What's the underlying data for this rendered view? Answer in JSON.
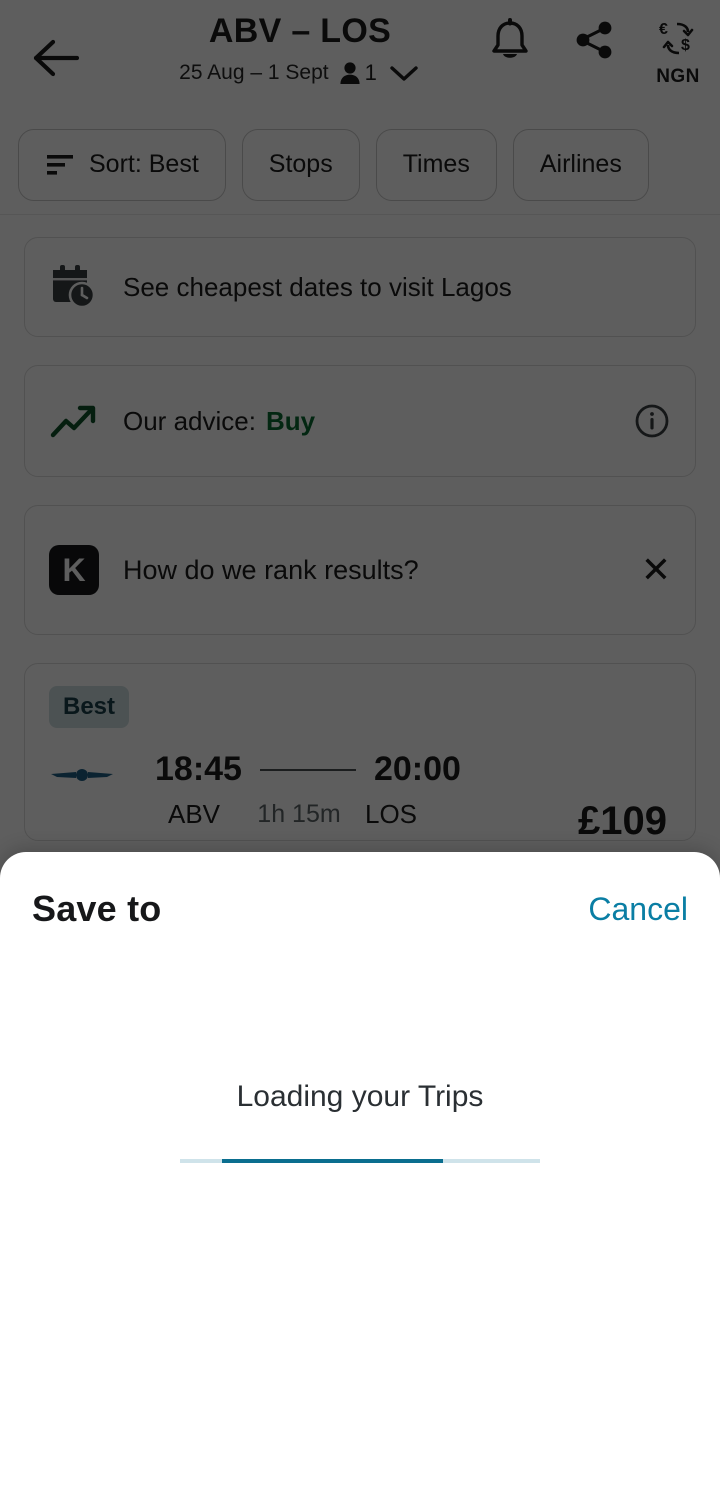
{
  "header": {
    "back_icon": "arrow-left-icon",
    "route_title": "ABV – LOS",
    "dates": "25 Aug – 1 Sept",
    "passenger_icon": "person-icon",
    "passenger_count": "1",
    "expand_icon": "chevron-down-icon",
    "alert_icon": "bell-icon",
    "share_icon": "share-icon",
    "currency_icon": "currency-exchange-icon",
    "currency_label": "NGN"
  },
  "filters": {
    "sort_icon": "sort-icon",
    "items": [
      {
        "label": "Sort: Best"
      },
      {
        "label": "Stops"
      },
      {
        "label": "Times"
      },
      {
        "label": "Airlines"
      }
    ]
  },
  "cards": {
    "cheapest_dates": {
      "icon": "calendar-clock-icon",
      "label": "See cheapest dates to visit Lagos"
    },
    "advice": {
      "icon": "trending-up-icon",
      "label": "Our advice:",
      "value": "Buy",
      "info_icon": "info-circle-icon"
    },
    "rank": {
      "logo": "kayak-k-logo",
      "logo_letter": "K",
      "label": "How do we rank results?",
      "close_icon": "close-icon"
    }
  },
  "flight": {
    "badge": "Best",
    "airline_logo": "airline-wings-logo",
    "depart_time": "18:45",
    "arrive_time": "20:00",
    "origin": "ABV",
    "destination": "LOS",
    "duration": "1h 15m",
    "price": "£109"
  },
  "sheet": {
    "title": "Save to",
    "cancel_label": "Cancel",
    "loading_text": "Loading your Trips",
    "progress": {
      "indeterminate": true,
      "track_color": "#cfe3ea",
      "bar_color": "#0a6e8f"
    }
  },
  "colors": {
    "accent": "#0a7ea4",
    "advice_green": "#0a6b31",
    "badge_bg": "#cfdde1",
    "badge_text": "#19404a",
    "overlay": "rgba(0,0,0,0.63)"
  }
}
